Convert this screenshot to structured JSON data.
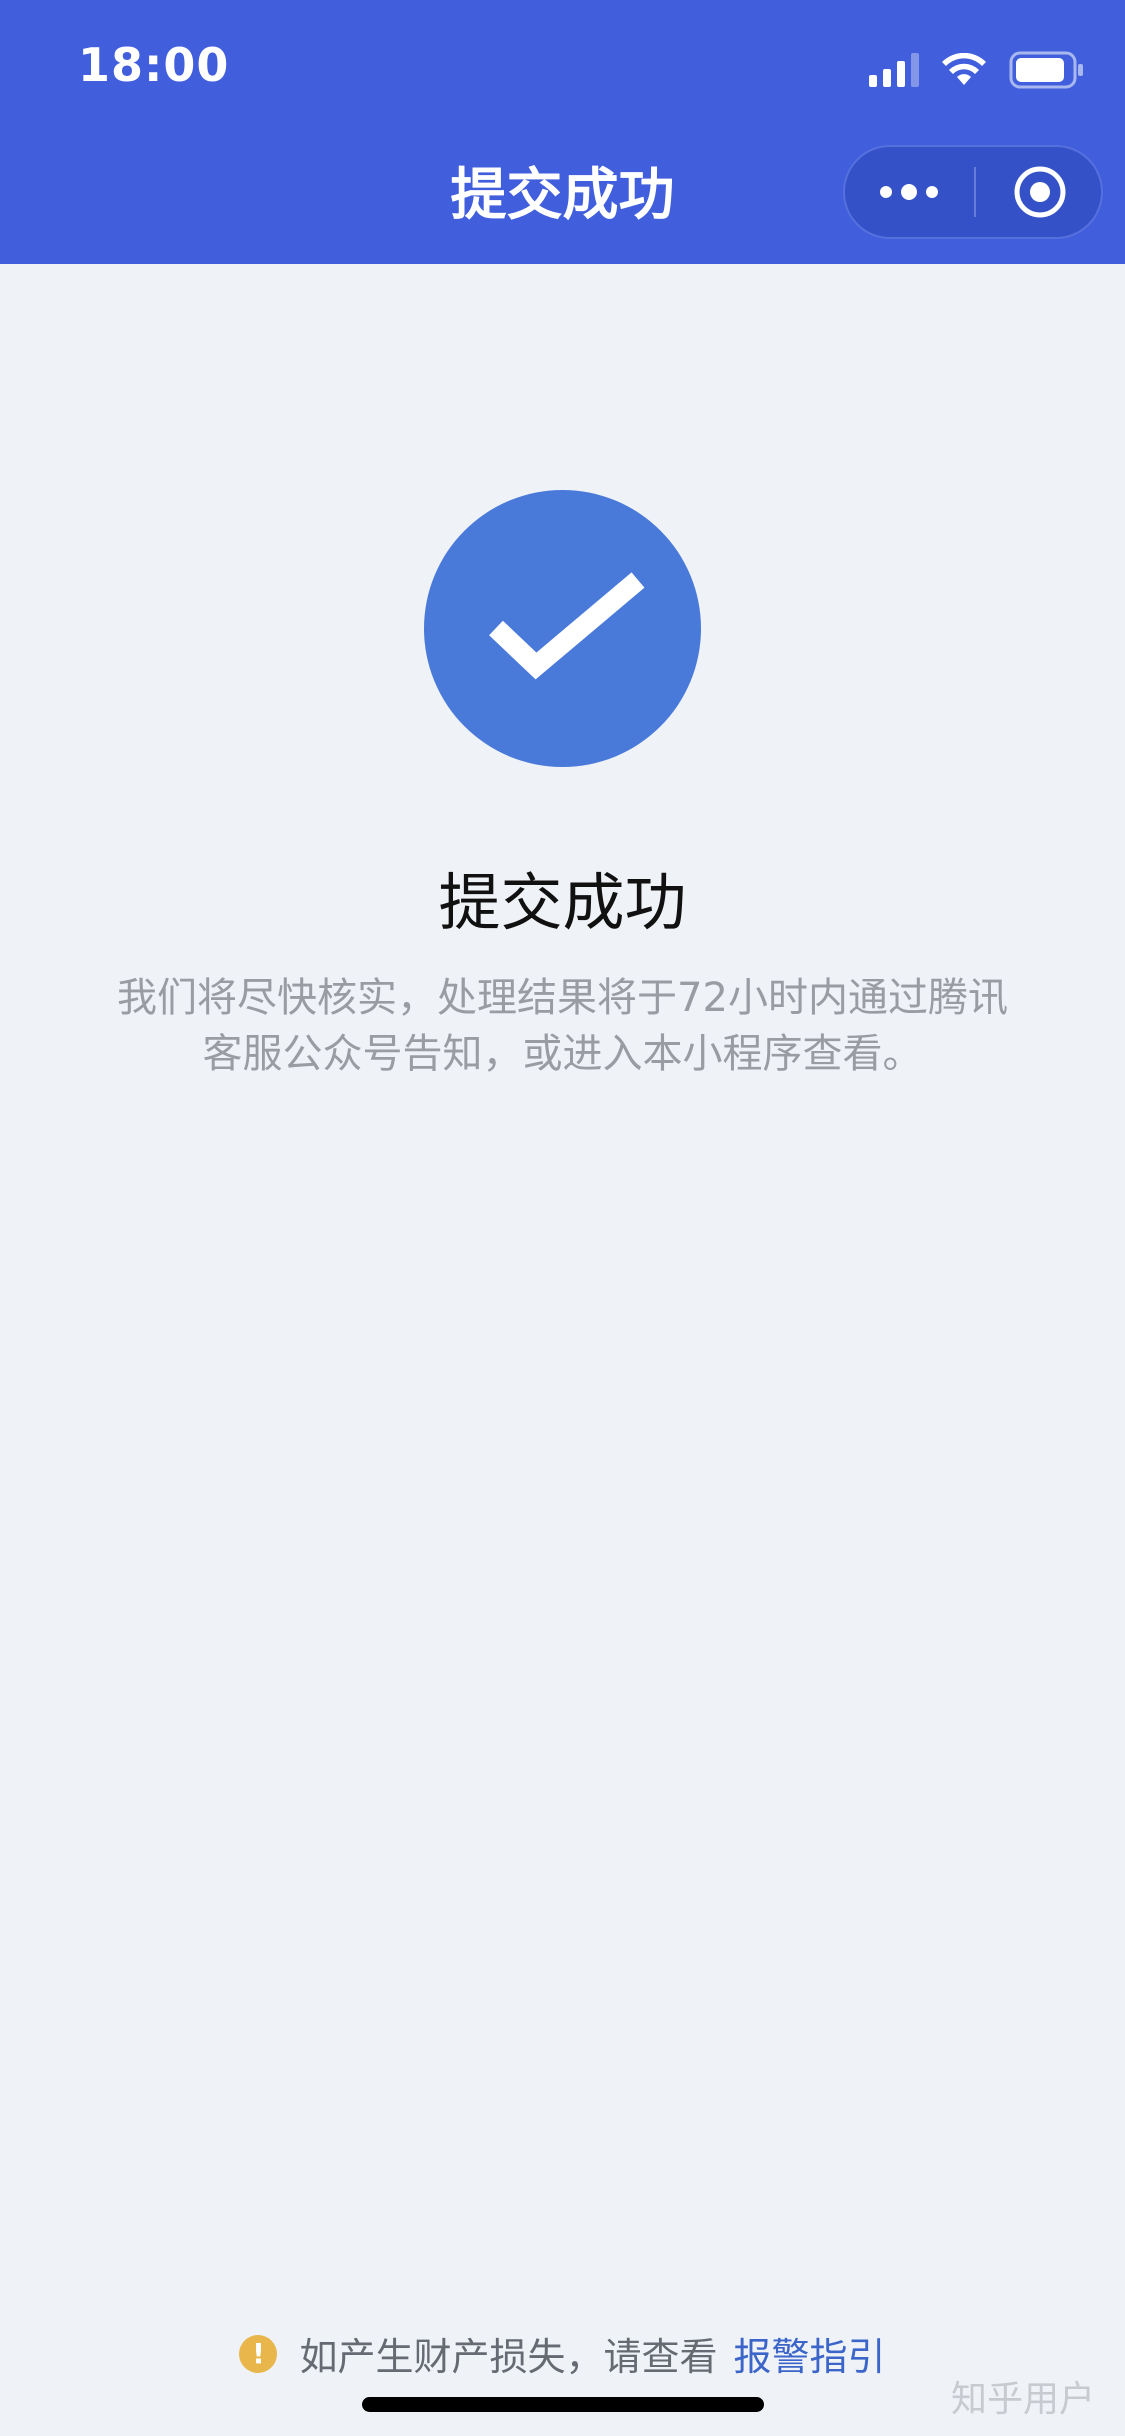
{
  "status_bar": {
    "time": "18:00",
    "icons": [
      "signal-icon",
      "wifi-icon",
      "battery-icon"
    ]
  },
  "nav": {
    "title": "提交成功",
    "capsule": {
      "more_icon": "more-dots-icon",
      "close_icon": "target-circle-icon"
    }
  },
  "result": {
    "icon": "check-circle-icon",
    "title": "提交成功",
    "description": "我们将尽快核实，处理结果将于72小时内通过腾讯客服公众号告知，或进入本小程序查看。"
  },
  "footer": {
    "warning_icon_glyph": "!",
    "note": "如产生财产损失，请查看",
    "link": "报警指引"
  },
  "watermark": "知乎用户",
  "colors": {
    "header_bg": "#415fdc",
    "page_bg": "#eff2f7",
    "success_circle": "#4a7ad9",
    "link": "#3b65c9",
    "warning": "#e8b64b"
  }
}
